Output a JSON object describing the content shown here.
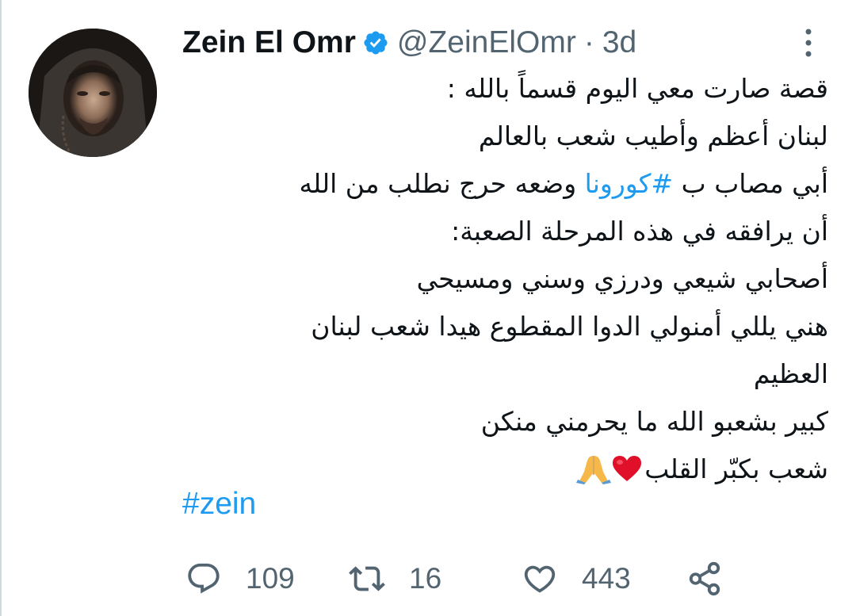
{
  "tweet": {
    "author": {
      "display_name": "Zein El Omr",
      "handle": "@ZeinElOmr",
      "separator": "·",
      "time": "3d",
      "verified": true
    },
    "lines": [
      "قصة صارت معي اليوم قسماً بالله :",
      "لبنان أعظم وأطيب شعب بالعالم",
      "وضعه حرج نطلب من الله",
      "أن يرافقه في هذه المرحلة الصعبة:",
      "أصحابي شيعي ودرزي وسني ومسيحي",
      "هني يللي أمنولي الدوا المقطوع هيدا شعب لبنان",
      "العظيم",
      "كبير بشعبو الله ما يحرمني منكن",
      "شعب بكبّر القلب"
    ],
    "line3_prefix": "أبي مصاب ب",
    "line3_hashtag": "#كورونا",
    "emoji_heart": "red-heart",
    "emoji_pray": "folded-hands",
    "hashtag": "#zein",
    "stats": {
      "replies": "109",
      "retweets": "16",
      "likes": "443"
    }
  },
  "colors": {
    "text": "#0f1419",
    "secondary": "#536471",
    "link": "#1d9bf0",
    "verified": "#1d9bf0",
    "heart": "#e0102a",
    "border": "#cfd9de"
  }
}
